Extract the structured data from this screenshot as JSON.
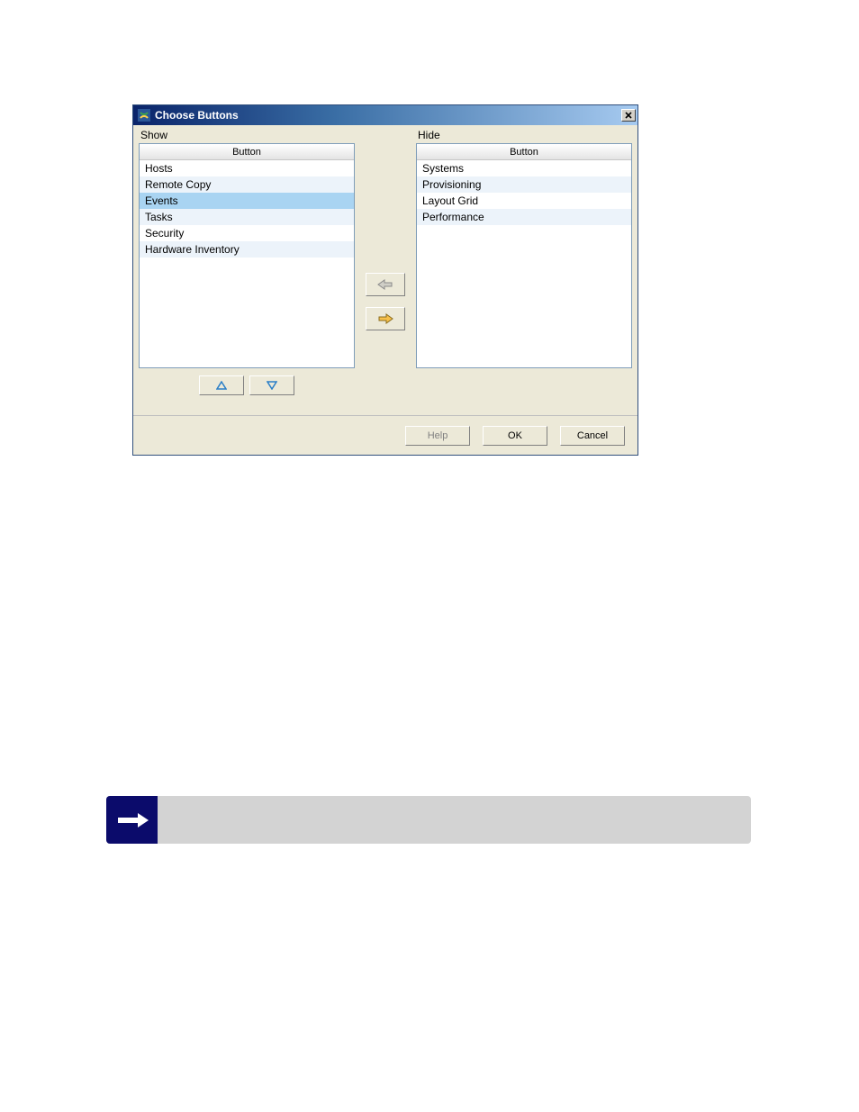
{
  "dialog": {
    "title": "Choose Buttons",
    "panels": {
      "show": {
        "label": "Show",
        "header": "Button",
        "items": [
          "Hosts",
          "Remote Copy",
          "Events",
          "Tasks",
          "Security",
          "Hardware Inventory"
        ],
        "selected_index": 2
      },
      "hide": {
        "label": "Hide",
        "header": "Button",
        "items": [
          "Systems",
          "Provisioning",
          "Layout Grid",
          "Performance"
        ],
        "selected_index": -1
      }
    },
    "footer": {
      "help": "Help",
      "ok": "OK",
      "cancel": "Cancel"
    }
  }
}
